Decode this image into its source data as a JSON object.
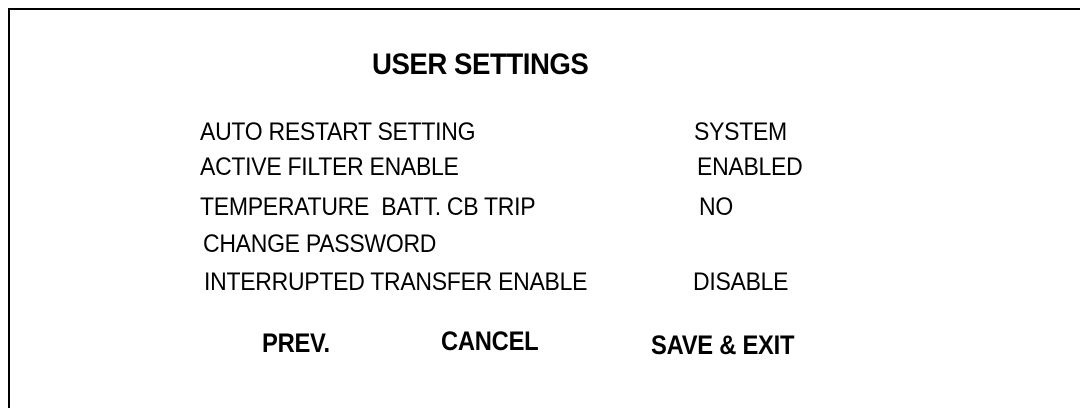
{
  "title": "USER SETTINGS",
  "settings": [
    {
      "label": "AUTO RESTART SETTING",
      "value": "SYSTEM"
    },
    {
      "label": "ACTIVE FILTER ENABLE",
      "value": "ENABLED"
    },
    {
      "label": "TEMPERATURE  BATT. CB TRIP",
      "value": "NO"
    },
    {
      "label": "CHANGE PASSWORD",
      "value": ""
    },
    {
      "label": "INTERRUPTED TRANSFER ENABLE",
      "value": "DISABLE"
    }
  ],
  "buttons": {
    "prev": "PREV.",
    "cancel": "CANCEL",
    "save_exit": "SAVE & EXIT"
  }
}
